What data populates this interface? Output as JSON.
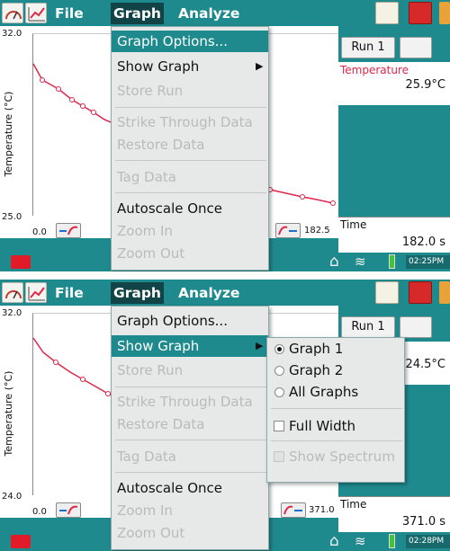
{
  "screens": [
    {
      "menubar": {
        "file": "File",
        "graph": "Graph",
        "analyze": "Analyze"
      },
      "graph": {
        "y_max": "32.0",
        "y_min": "25.0",
        "y_label": "Temperature (°C)",
        "x_min": "0.0",
        "x_max": "182.5"
      },
      "run_button": "Run 1",
      "meter": {
        "label": "Temperature",
        "value": "25.9°C"
      },
      "time": {
        "label": "Time",
        "value": "182.0 s"
      },
      "clock": "02:25PM",
      "graph_menu": {
        "highlighted": "Graph Options...",
        "items": [
          {
            "label": "Graph Options...",
            "enabled": true
          },
          {
            "label": "Show Graph",
            "enabled": true,
            "submenu": true
          },
          {
            "label": "Store Run",
            "enabled": false
          },
          {
            "label": "Strike Through Data",
            "enabled": false
          },
          {
            "label": "Restore Data",
            "enabled": false
          },
          {
            "label": "Tag Data",
            "enabled": false
          },
          {
            "label": "Autoscale Once",
            "enabled": true
          },
          {
            "label": "Zoom In",
            "enabled": false
          },
          {
            "label": "Zoom Out",
            "enabled": false
          }
        ]
      }
    },
    {
      "menubar": {
        "file": "File",
        "graph": "Graph",
        "analyze": "Analyze"
      },
      "graph": {
        "y_max": "32.0",
        "y_min": "24.0",
        "y_label": "Temperature (°C)",
        "x_min": "0.0",
        "x_max": "371.0"
      },
      "run_button": "Run 1",
      "meter": {
        "label": "re",
        "value": "24.5°C"
      },
      "time": {
        "label": "Time",
        "value": "371.0 s"
      },
      "clock": "02:28PM",
      "graph_menu": {
        "highlighted": "Show Graph",
        "items": [
          {
            "label": "Graph Options...",
            "enabled": true
          },
          {
            "label": "Show Graph",
            "enabled": true,
            "submenu": true
          },
          {
            "label": "Store Run",
            "enabled": false
          },
          {
            "label": "Strike Through Data",
            "enabled": false
          },
          {
            "label": "Restore Data",
            "enabled": false
          },
          {
            "label": "Tag Data",
            "enabled": false
          },
          {
            "label": "Autoscale Once",
            "enabled": true
          },
          {
            "label": "Zoom In",
            "enabled": false
          },
          {
            "label": "Zoom Out",
            "enabled": false
          }
        ]
      },
      "show_graph_submenu": {
        "items": [
          {
            "label": "Graph 1",
            "type": "radio",
            "selected": true,
            "enabled": true
          },
          {
            "label": "Graph 2",
            "type": "radio",
            "selected": false,
            "enabled": true
          },
          {
            "label": "All Graphs",
            "type": "radio",
            "selected": false,
            "enabled": true
          },
          {
            "label": "Full Width",
            "type": "checkbox",
            "checked": false,
            "enabled": true
          },
          {
            "label": "Show Spectrum",
            "type": "checkbox",
            "checked": false,
            "enabled": false
          }
        ]
      }
    }
  ],
  "colors": {
    "teal": "#1f8a8e",
    "trace": "#e0264a",
    "menu_bg": "#e6e9e8"
  }
}
